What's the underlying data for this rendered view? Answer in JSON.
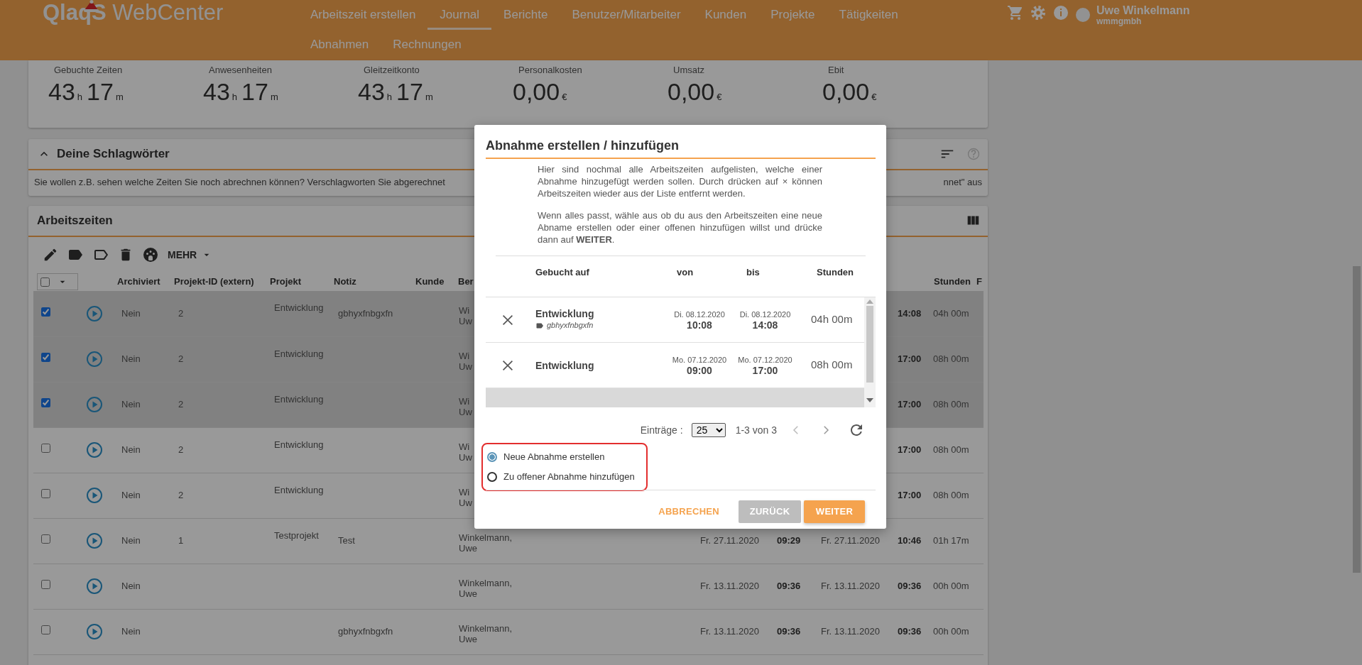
{
  "header": {
    "logo": "**QlaqS** WebCenter",
    "nav_rows": [
      [
        {
          "label": "Arbeitszeit erstellen",
          "selected": false
        },
        {
          "label": "Journal",
          "selected": true
        },
        {
          "label": "Berichte",
          "selected": false
        },
        {
          "label": "Benutzer/Mitarbeiter",
          "selected": false
        },
        {
          "label": "Kunden",
          "selected": false
        },
        {
          "label": "Projekte",
          "selected": false
        },
        {
          "label": "Tätigkeiten",
          "selected": false
        }
      ],
      [
        {
          "label": "Abnahmen",
          "selected": false
        },
        {
          "label": "Rechnungen",
          "selected": false
        }
      ]
    ],
    "user": {
      "name": "Uwe Winkelmann",
      "company": "wmmgmbh"
    }
  },
  "stats": [
    {
      "label": "Gebuchte Zeiten",
      "kind": "duration",
      "hours": "43",
      "hours_unit": "h",
      "minutes": "17",
      "minutes_unit": "m"
    },
    {
      "label": "Anwesenheiten",
      "kind": "duration",
      "hours": "43",
      "hours_unit": "h",
      "minutes": "17",
      "minutes_unit": "m"
    },
    {
      "label": "Gleitzeitkonto",
      "kind": "duration",
      "hours": "43",
      "hours_unit": "h",
      "minutes": "17",
      "minutes_unit": "m"
    },
    {
      "label": "Personalkosten",
      "kind": "money",
      "amount": "0,00",
      "currency": "€"
    },
    {
      "label": "Umsatz",
      "kind": "money",
      "amount": "0,00",
      "currency": "€"
    },
    {
      "label": "Ebit",
      "kind": "money",
      "amount": "0,00",
      "currency": "€"
    }
  ],
  "keywords_panel": {
    "title": "Deine Schlagwörter",
    "expanded": true,
    "hint_left": "Sie wollen z.B. sehen welche Zeiten Sie noch abrechnen können? Verschlagworten Sie abgerechnet",
    "hint_right": "nnet\" aus"
  },
  "worktimes": {
    "title": "Arbeitszeiten",
    "more_label": "MEHR",
    "select_all": {
      "checked": false
    },
    "columns": [
      "Archiviert",
      "Projekt-ID (extern)",
      "Projekt",
      "Notiz",
      "Kunde",
      "Ber",
      "Stunden",
      "F"
    ],
    "rows": [
      {
        "selected": true,
        "archived": "Nein",
        "project_id": "2",
        "project": "Entwicklung",
        "note": "gbhyxfnbgxfn",
        "editor": [
          "Wi",
          "Uw"
        ],
        "end_time": "14:08",
        "hours": "04h 00m"
      },
      {
        "selected": true,
        "archived": "Nein",
        "project_id": "2",
        "project": "Entwicklung",
        "editor": [
          "Wi",
          "Uw"
        ],
        "end_time": "17:00",
        "hours": "08h 00m"
      },
      {
        "selected": true,
        "archived": "Nein",
        "project_id": "2",
        "project": "Entwicklung",
        "editor": [
          "Wi",
          "Uw"
        ],
        "end_time": "17:00",
        "hours": "08h 00m"
      },
      {
        "selected": false,
        "archived": "Nein",
        "project_id": "2",
        "project": "Entwicklung",
        "editor": [
          "Wi",
          "Uw"
        ],
        "end_time": "17:00",
        "hours": "08h 00m"
      },
      {
        "selected": false,
        "archived": "Nein",
        "project_id": "2",
        "project": "Entwicklung",
        "editor": [
          "Wi",
          "Uw"
        ],
        "end_time": "17:00",
        "hours": "08h 00m"
      },
      {
        "selected": false,
        "archived": "Nein",
        "project_id": "1",
        "project": "Testprojekt",
        "note": "Test",
        "editor": [
          "Winkelmann,",
          "Uwe"
        ],
        "start_date": "Fr. 27.11.2020",
        "start_time": "09:29",
        "end_date": "Fr. 27.11.2020",
        "end_time": "10:46",
        "hours": "01h 17m"
      },
      {
        "selected": false,
        "archived": "Nein",
        "editor": [
          "Winkelmann,",
          "Uwe"
        ],
        "start_date": "Fr. 13.11.2020",
        "start_time": "09:36",
        "end_date": "Fr. 13.11.2020",
        "end_time": "09:36",
        "hours": "00h 00m"
      },
      {
        "selected": false,
        "archived": "Nein",
        "note": "gbhyxfnbgxfn",
        "editor": [
          "Winkelmann,",
          "Uwe"
        ],
        "start_date": "Fr. 13.11.2020",
        "start_time": "09:36",
        "end_date": "Fr. 13.11.2020",
        "end_time": "09:36",
        "hours": "00h 00m"
      }
    ]
  },
  "dialog": {
    "title": "Abnahme erstellen / hinzufügen",
    "intro": [
      "Hier sind nochmal alle Arbeitszeiten aufgelisten, welche einer Abnahme hinzugefügt werden sollen. Durch drücken auf × können Arbeitszeiten wieder aus der Liste entfernt werden.",
      "Wenn alles passt, wähle aus ob du aus den Arbeitszeiten eine neue Abname erstellen oder einer offenen hinzufügen willst und drücke dann auf **WEITER**."
    ],
    "columns": [
      "Gebucht auf",
      "von",
      "bis",
      "Stunden"
    ],
    "entries": [
      {
        "selected": false,
        "project": "Entwicklung",
        "note": "gbhyxfnbgxfn",
        "from_date": "Di. 08.12.2020",
        "from_time": "10:08",
        "to_date": "Di. 08.12.2020",
        "to_time": "14:08",
        "hours": "04h 00m"
      },
      {
        "selected": false,
        "project": "Entwicklung",
        "from_date": "Mo. 07.12.2020",
        "from_time": "09:00",
        "to_date": "Mo. 07.12.2020",
        "to_time": "17:00",
        "hours": "08h 00m"
      },
      {
        "selected": true
      }
    ],
    "pagination": {
      "label": "Einträge :",
      "page_size": "25",
      "range": "1-3 von 3"
    },
    "options": [
      {
        "label": "Neue Abnahme erstellen",
        "selected": true
      },
      {
        "label": "Zu offener Abnahme hinzufügen",
        "selected": false
      }
    ],
    "buttons": [
      {
        "label": "ABBRECHEN",
        "kind": "text"
      },
      {
        "label": "ZURÜCK",
        "kind": "secondary"
      },
      {
        "label": "WEITER",
        "kind": "primary"
      }
    ]
  }
}
